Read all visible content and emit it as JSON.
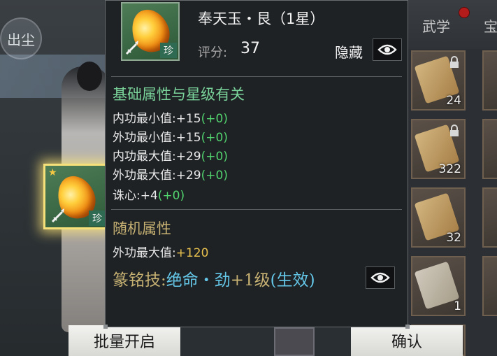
{
  "background": {
    "logo_text": "出尘",
    "tabs": [
      "武学",
      "宝"
    ],
    "inventory_counts": [
      "24",
      "322",
      "32",
      "1"
    ],
    "footer_buttons": {
      "batch_open": "批量开启",
      "confirm": "确认"
    }
  },
  "selected_slot": {
    "rarity": "珍"
  },
  "tooltip": {
    "title": "奉天玉・艮（1星）",
    "rarity": "珍",
    "score_label": "评分:",
    "score_value": "37",
    "hide_label": "隐藏",
    "base_section": {
      "title": "基础属性与星级有关",
      "rows": [
        {
          "label": "内功最小值:",
          "value": "+15",
          "bonus": "(+0)"
        },
        {
          "label": "外功最小值:",
          "value": "+15",
          "bonus": "(+0)"
        },
        {
          "label": "内功最大值:",
          "value": "+29",
          "bonus": "(+0)"
        },
        {
          "label": "外功最大值:",
          "value": "+29",
          "bonus": "(+0)"
        },
        {
          "label": "诛心:",
          "value": "+4",
          "bonus": "(+0)"
        }
      ]
    },
    "random_section": {
      "title": "随机属性",
      "rows": [
        {
          "label": "外功最大值:",
          "value": "+120"
        }
      ]
    },
    "skill": {
      "prefix": "篆铭技:",
      "name": "绝命・劲",
      "level": "+1级",
      "effect": "(生效)"
    }
  },
  "colors": {
    "section_title_green": "#7ad39a",
    "section_title_gold": "#c8b273",
    "bonus_green": "#52d46e",
    "value_gold": "#e7c04e",
    "skill_blue": "#65c7e8"
  }
}
